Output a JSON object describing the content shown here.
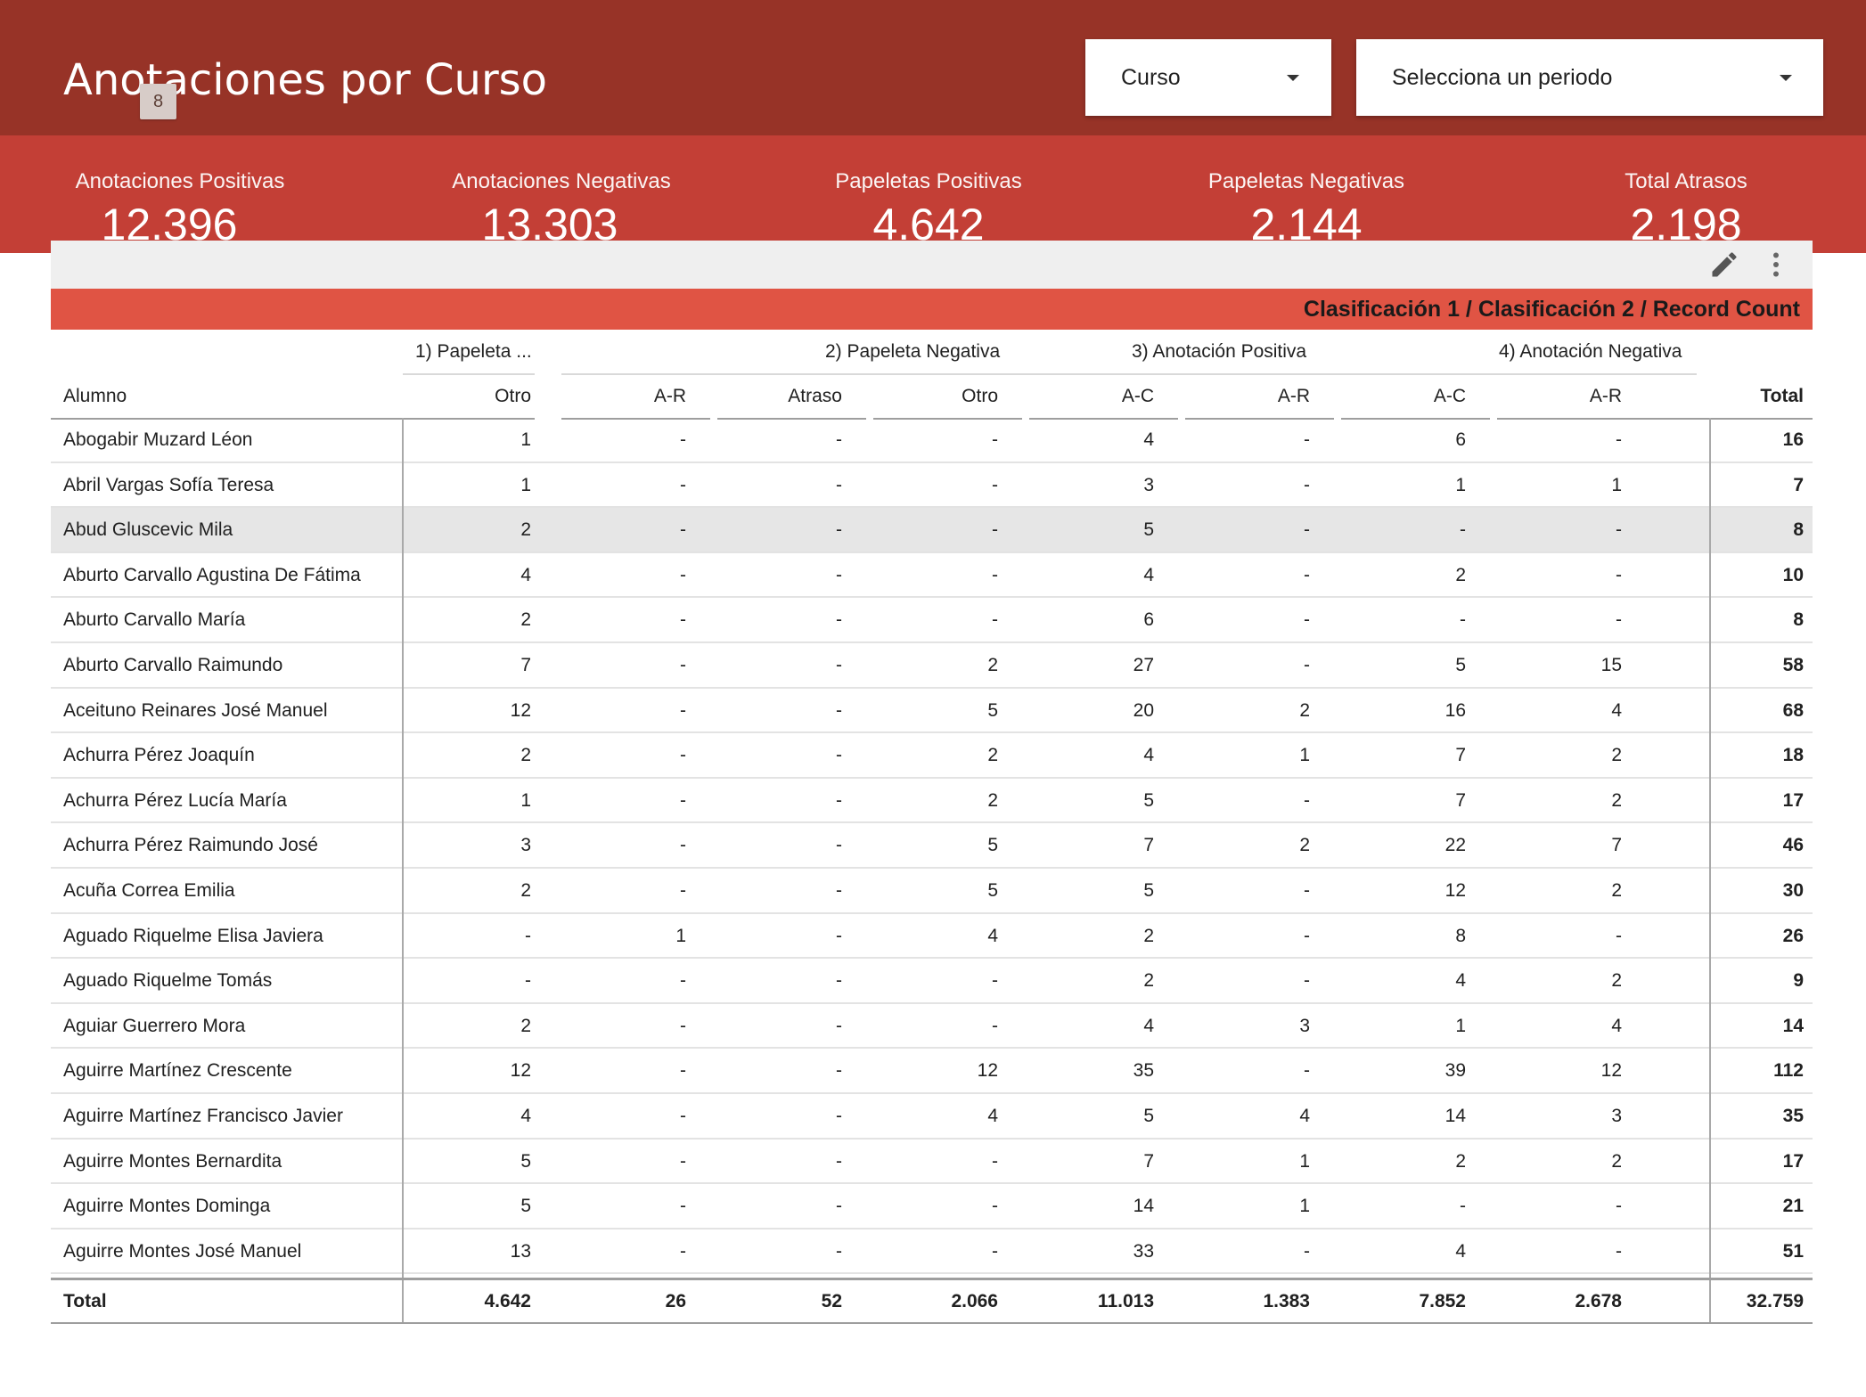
{
  "header": {
    "title": "Anotaciones por Curso",
    "badge": "8",
    "curso_select": "Curso",
    "periodo_select": "Selecciona un periodo",
    "bg_color": "#973327"
  },
  "kpis": [
    {
      "label": "Anotaciones Positivas",
      "value": "12.396"
    },
    {
      "label": "Anotaciones Negativas",
      "value": "13.303"
    },
    {
      "label": "Papeletas Positivas",
      "value": "4.642"
    },
    {
      "label": "Papeletas Negativas",
      "value": "2.144"
    },
    {
      "label": "Total Atrasos",
      "value": "2.198"
    }
  ],
  "toolbar": {
    "edit_icon": "pencil-icon",
    "menu_icon": "more-vertical-icon"
  },
  "table": {
    "banner": "Clasificación 1 / Clasificación 2 / Record Count",
    "groups": [
      "1) Papeleta ...",
      "2) Papeleta Negativa",
      "3) Anotación Positiva",
      "4) Anotación Negativa"
    ],
    "name_header": "Alumno",
    "columns": [
      "Otro",
      "A-R",
      "Atraso",
      "Otro",
      "A-C",
      "A-R",
      "A-C",
      "A-R"
    ],
    "total_header": "Total",
    "rows": [
      {
        "name": "Abogabir Muzard Léon",
        "values": [
          "1",
          "-",
          "-",
          "-",
          "4",
          "-",
          "6",
          "-"
        ],
        "total": "16"
      },
      {
        "name": "Abril Vargas Sofía Teresa",
        "values": [
          "1",
          "-",
          "-",
          "-",
          "3",
          "-",
          "1",
          "1"
        ],
        "total": "7"
      },
      {
        "name": "Abud Gluscevic Mila",
        "values": [
          "2",
          "-",
          "-",
          "-",
          "5",
          "-",
          "-",
          "-"
        ],
        "total": "8"
      },
      {
        "name": "Aburto Carvallo Agustina De Fátima",
        "values": [
          "4",
          "-",
          "-",
          "-",
          "4",
          "-",
          "2",
          "-"
        ],
        "total": "10"
      },
      {
        "name": "Aburto Carvallo María",
        "values": [
          "2",
          "-",
          "-",
          "-",
          "6",
          "-",
          "-",
          "-"
        ],
        "total": "8"
      },
      {
        "name": "Aburto Carvallo Raimundo",
        "values": [
          "7",
          "-",
          "-",
          "2",
          "27",
          "-",
          "5",
          "15"
        ],
        "total": "58"
      },
      {
        "name": "Aceituno Reinares José Manuel",
        "values": [
          "12",
          "-",
          "-",
          "5",
          "20",
          "2",
          "16",
          "4"
        ],
        "total": "68"
      },
      {
        "name": "Achurra Pérez Joaquín",
        "values": [
          "2",
          "-",
          "-",
          "2",
          "4",
          "1",
          "7",
          "2"
        ],
        "total": "18"
      },
      {
        "name": "Achurra Pérez Lucía María",
        "values": [
          "1",
          "-",
          "-",
          "2",
          "5",
          "-",
          "7",
          "2"
        ],
        "total": "17"
      },
      {
        "name": "Achurra Pérez Raimundo José",
        "values": [
          "3",
          "-",
          "-",
          "5",
          "7",
          "2",
          "22",
          "7"
        ],
        "total": "46"
      },
      {
        "name": "Acuña Correa Emilia",
        "values": [
          "2",
          "-",
          "-",
          "5",
          "5",
          "-",
          "12",
          "2"
        ],
        "total": "30"
      },
      {
        "name": "Aguado Riquelme Elisa Javiera",
        "values": [
          "-",
          "1",
          "-",
          "4",
          "2",
          "-",
          "8",
          "-"
        ],
        "total": "26"
      },
      {
        "name": "Aguado Riquelme Tomás",
        "values": [
          "-",
          "-",
          "-",
          "-",
          "2",
          "-",
          "4",
          "2"
        ],
        "total": "9"
      },
      {
        "name": "Aguiar Guerrero Mora",
        "values": [
          "2",
          "-",
          "-",
          "-",
          "4",
          "3",
          "1",
          "4"
        ],
        "total": "14"
      },
      {
        "name": "Aguirre Martínez Crescente",
        "values": [
          "12",
          "-",
          "-",
          "12",
          "35",
          "-",
          "39",
          "12"
        ],
        "total": "112"
      },
      {
        "name": "Aguirre Martínez Francisco Javier",
        "values": [
          "4",
          "-",
          "-",
          "4",
          "5",
          "4",
          "14",
          "3"
        ],
        "total": "35"
      },
      {
        "name": "Aguirre Montes Bernardita",
        "values": [
          "5",
          "-",
          "-",
          "-",
          "7",
          "1",
          "2",
          "2"
        ],
        "total": "17"
      },
      {
        "name": "Aguirre Montes Dominga",
        "values": [
          "5",
          "-",
          "-",
          "-",
          "14",
          "1",
          "-",
          "-"
        ],
        "total": "21"
      },
      {
        "name": "Aguirre Montes José Manuel",
        "values": [
          "13",
          "-",
          "-",
          "-",
          "33",
          "-",
          "4",
          "-"
        ],
        "total": "51"
      }
    ],
    "totals": {
      "label": "Total",
      "values": [
        "4.642",
        "26",
        "52",
        "2.066",
        "11.013",
        "1.383",
        "7.852",
        "2.678"
      ],
      "total": "32.759"
    }
  }
}
